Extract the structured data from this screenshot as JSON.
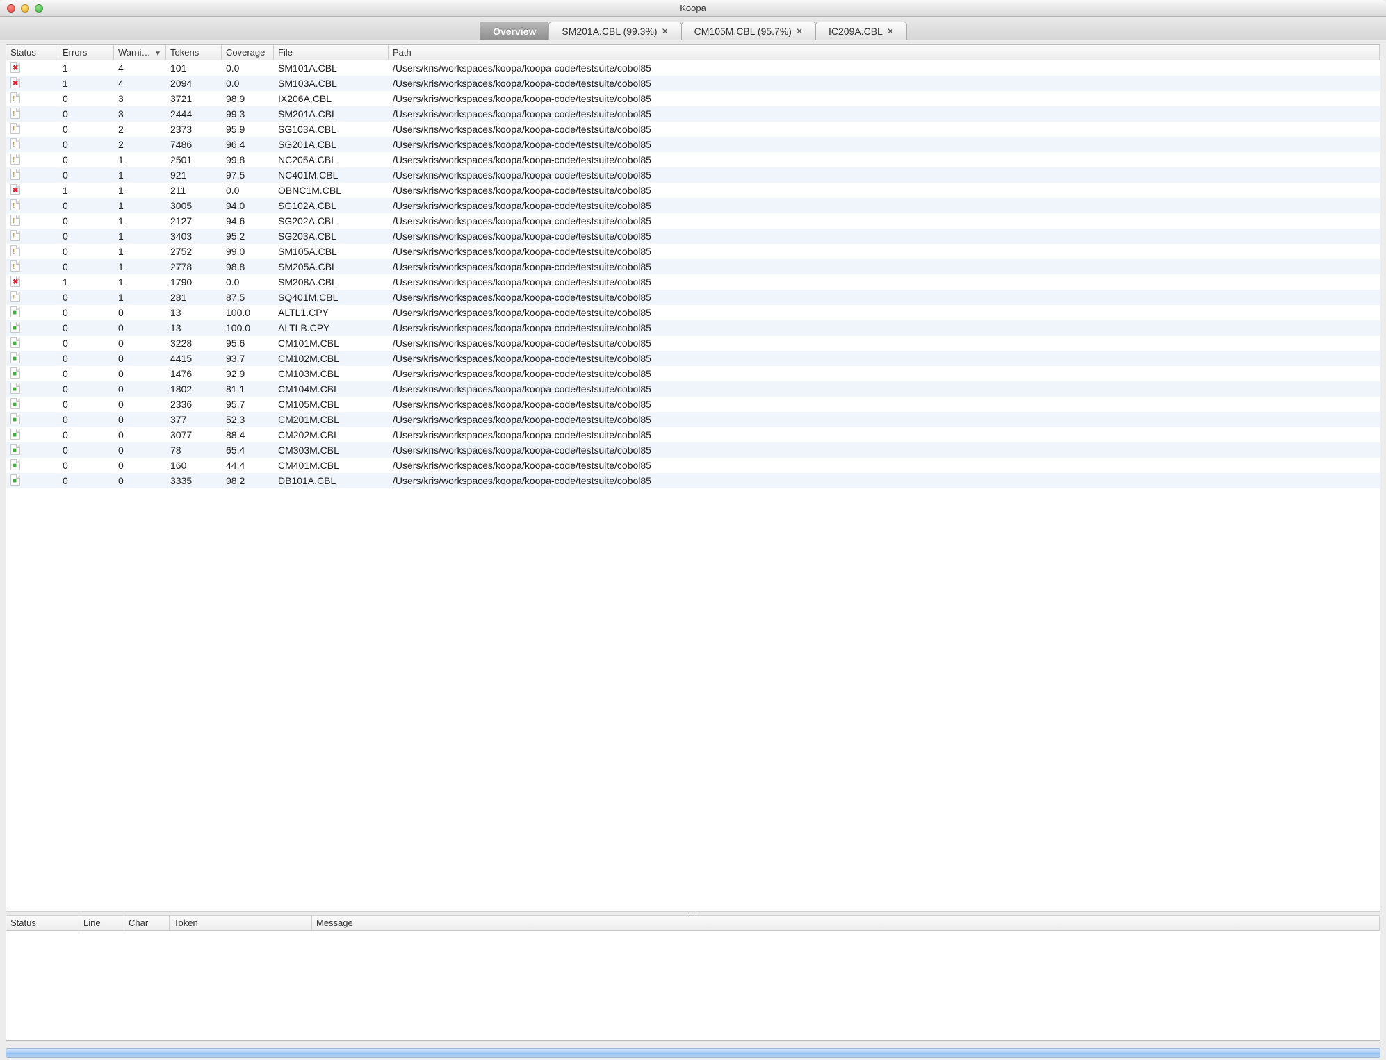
{
  "window": {
    "title": "Koopa"
  },
  "tabs": [
    {
      "label": "Overview",
      "closable": false,
      "active": true
    },
    {
      "label": "SM201A.CBL (99.3%)",
      "closable": true,
      "active": false
    },
    {
      "label": "CM105M.CBL (95.7%)",
      "closable": true,
      "active": false
    },
    {
      "label": "IC209A.CBL",
      "closable": true,
      "active": false
    }
  ],
  "main_table": {
    "columns": {
      "status": "Status",
      "errors": "Errors",
      "warnings": "Warni…",
      "tokens": "Tokens",
      "coverage": "Coverage",
      "file": "File",
      "path": "Path"
    },
    "sort_indicator": "▼",
    "rows": [
      {
        "status": "error",
        "errors": 1,
        "warnings": 4,
        "tokens": 101,
        "coverage": "0.0",
        "file": "SM101A.CBL",
        "path": "/Users/kris/workspaces/koopa/koopa-code/testsuite/cobol85"
      },
      {
        "status": "error",
        "errors": 1,
        "warnings": 4,
        "tokens": 2094,
        "coverage": "0.0",
        "file": "SM103A.CBL",
        "path": "/Users/kris/workspaces/koopa/koopa-code/testsuite/cobol85"
      },
      {
        "status": "warn",
        "errors": 0,
        "warnings": 3,
        "tokens": 3721,
        "coverage": "98.9",
        "file": "IX206A.CBL",
        "path": "/Users/kris/workspaces/koopa/koopa-code/testsuite/cobol85"
      },
      {
        "status": "warn",
        "errors": 0,
        "warnings": 3,
        "tokens": 2444,
        "coverage": "99.3",
        "file": "SM201A.CBL",
        "path": "/Users/kris/workspaces/koopa/koopa-code/testsuite/cobol85"
      },
      {
        "status": "warn",
        "errors": 0,
        "warnings": 2,
        "tokens": 2373,
        "coverage": "95.9",
        "file": "SG103A.CBL",
        "path": "/Users/kris/workspaces/koopa/koopa-code/testsuite/cobol85"
      },
      {
        "status": "warn",
        "errors": 0,
        "warnings": 2,
        "tokens": 7486,
        "coverage": "96.4",
        "file": "SG201A.CBL",
        "path": "/Users/kris/workspaces/koopa/koopa-code/testsuite/cobol85"
      },
      {
        "status": "warn",
        "errors": 0,
        "warnings": 1,
        "tokens": 2501,
        "coverage": "99.8",
        "file": "NC205A.CBL",
        "path": "/Users/kris/workspaces/koopa/koopa-code/testsuite/cobol85"
      },
      {
        "status": "warn",
        "errors": 0,
        "warnings": 1,
        "tokens": 921,
        "coverage": "97.5",
        "file": "NC401M.CBL",
        "path": "/Users/kris/workspaces/koopa/koopa-code/testsuite/cobol85"
      },
      {
        "status": "error",
        "errors": 1,
        "warnings": 1,
        "tokens": 211,
        "coverage": "0.0",
        "file": "OBNC1M.CBL",
        "path": "/Users/kris/workspaces/koopa/koopa-code/testsuite/cobol85"
      },
      {
        "status": "warn",
        "errors": 0,
        "warnings": 1,
        "tokens": 3005,
        "coverage": "94.0",
        "file": "SG102A.CBL",
        "path": "/Users/kris/workspaces/koopa/koopa-code/testsuite/cobol85"
      },
      {
        "status": "warn",
        "errors": 0,
        "warnings": 1,
        "tokens": 2127,
        "coverage": "94.6",
        "file": "SG202A.CBL",
        "path": "/Users/kris/workspaces/koopa/koopa-code/testsuite/cobol85"
      },
      {
        "status": "warn",
        "errors": 0,
        "warnings": 1,
        "tokens": 3403,
        "coverage": "95.2",
        "file": "SG203A.CBL",
        "path": "/Users/kris/workspaces/koopa/koopa-code/testsuite/cobol85"
      },
      {
        "status": "warn",
        "errors": 0,
        "warnings": 1,
        "tokens": 2752,
        "coverage": "99.0",
        "file": "SM105A.CBL",
        "path": "/Users/kris/workspaces/koopa/koopa-code/testsuite/cobol85"
      },
      {
        "status": "warn",
        "errors": 0,
        "warnings": 1,
        "tokens": 2778,
        "coverage": "98.8",
        "file": "SM205A.CBL",
        "path": "/Users/kris/workspaces/koopa/koopa-code/testsuite/cobol85"
      },
      {
        "status": "error",
        "errors": 1,
        "warnings": 1,
        "tokens": 1790,
        "coverage": "0.0",
        "file": "SM208A.CBL",
        "path": "/Users/kris/workspaces/koopa/koopa-code/testsuite/cobol85"
      },
      {
        "status": "warn",
        "errors": 0,
        "warnings": 1,
        "tokens": 281,
        "coverage": "87.5",
        "file": "SQ401M.CBL",
        "path": "/Users/kris/workspaces/koopa/koopa-code/testsuite/cobol85"
      },
      {
        "status": "ok",
        "errors": 0,
        "warnings": 0,
        "tokens": 13,
        "coverage": "100.0",
        "file": "ALTL1.CPY",
        "path": "/Users/kris/workspaces/koopa/koopa-code/testsuite/cobol85"
      },
      {
        "status": "ok",
        "errors": 0,
        "warnings": 0,
        "tokens": 13,
        "coverage": "100.0",
        "file": "ALTLB.CPY",
        "path": "/Users/kris/workspaces/koopa/koopa-code/testsuite/cobol85"
      },
      {
        "status": "ok",
        "errors": 0,
        "warnings": 0,
        "tokens": 3228,
        "coverage": "95.6",
        "file": "CM101M.CBL",
        "path": "/Users/kris/workspaces/koopa/koopa-code/testsuite/cobol85"
      },
      {
        "status": "ok",
        "errors": 0,
        "warnings": 0,
        "tokens": 4415,
        "coverage": "93.7",
        "file": "CM102M.CBL",
        "path": "/Users/kris/workspaces/koopa/koopa-code/testsuite/cobol85"
      },
      {
        "status": "ok",
        "errors": 0,
        "warnings": 0,
        "tokens": 1476,
        "coverage": "92.9",
        "file": "CM103M.CBL",
        "path": "/Users/kris/workspaces/koopa/koopa-code/testsuite/cobol85"
      },
      {
        "status": "ok",
        "errors": 0,
        "warnings": 0,
        "tokens": 1802,
        "coverage": "81.1",
        "file": "CM104M.CBL",
        "path": "/Users/kris/workspaces/koopa/koopa-code/testsuite/cobol85"
      },
      {
        "status": "ok",
        "errors": 0,
        "warnings": 0,
        "tokens": 2336,
        "coverage": "95.7",
        "file": "CM105M.CBL",
        "path": "/Users/kris/workspaces/koopa/koopa-code/testsuite/cobol85"
      },
      {
        "status": "ok",
        "errors": 0,
        "warnings": 0,
        "tokens": 377,
        "coverage": "52.3",
        "file": "CM201M.CBL",
        "path": "/Users/kris/workspaces/koopa/koopa-code/testsuite/cobol85"
      },
      {
        "status": "ok",
        "errors": 0,
        "warnings": 0,
        "tokens": 3077,
        "coverage": "88.4",
        "file": "CM202M.CBL",
        "path": "/Users/kris/workspaces/koopa/koopa-code/testsuite/cobol85"
      },
      {
        "status": "ok",
        "errors": 0,
        "warnings": 0,
        "tokens": 78,
        "coverage": "65.4",
        "file": "CM303M.CBL",
        "path": "/Users/kris/workspaces/koopa/koopa-code/testsuite/cobol85"
      },
      {
        "status": "ok",
        "errors": 0,
        "warnings": 0,
        "tokens": 160,
        "coverage": "44.4",
        "file": "CM401M.CBL",
        "path": "/Users/kris/workspaces/koopa/koopa-code/testsuite/cobol85"
      },
      {
        "status": "ok",
        "errors": 0,
        "warnings": 0,
        "tokens": 3335,
        "coverage": "98.2",
        "file": "DB101A.CBL",
        "path": "/Users/kris/workspaces/koopa/koopa-code/testsuite/cobol85"
      }
    ]
  },
  "detail_table": {
    "columns": {
      "status": "Status",
      "line": "Line",
      "char": "Char",
      "token": "Token",
      "message": "Message"
    }
  },
  "status_marks": {
    "error": "✖",
    "warn": "!",
    "ok": "■"
  }
}
